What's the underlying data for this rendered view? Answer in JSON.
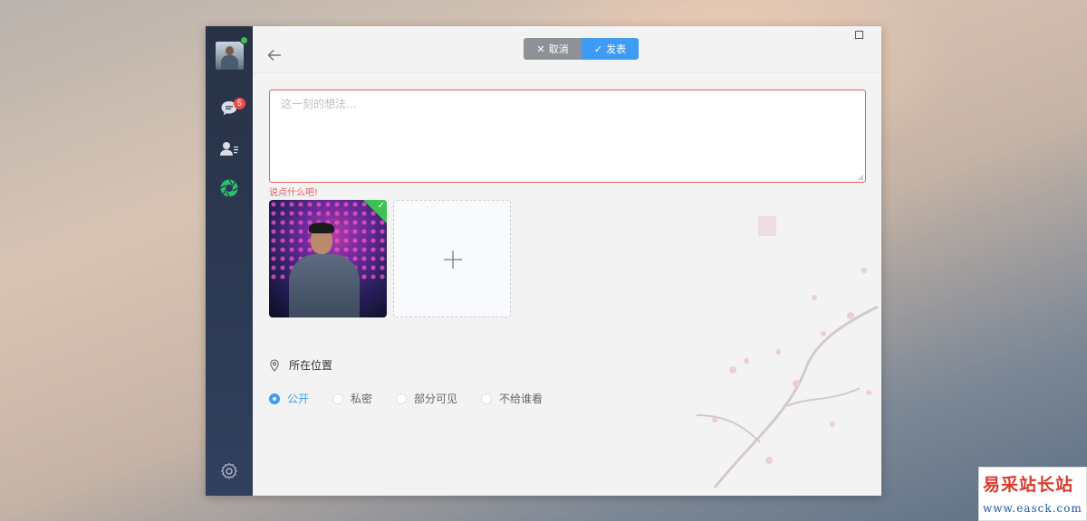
{
  "sidebar": {
    "chat_badge": "5"
  },
  "toolbar": {
    "cancel_label": "取消",
    "publish_label": "发表"
  },
  "editor": {
    "placeholder": "这一刻的想法...",
    "validation_message": "说点什么吧!"
  },
  "location": {
    "label": "所在位置"
  },
  "privacy": {
    "options": [
      {
        "label": "公开",
        "selected": true
      },
      {
        "label": "私密",
        "selected": false
      },
      {
        "label": "部分可见",
        "selected": false
      },
      {
        "label": "不给谁看",
        "selected": false
      }
    ]
  },
  "watermark": {
    "title": "易采站长站",
    "url": "www.easck.com"
  },
  "colors": {
    "accent": "#3f9cf4",
    "error": "#e35d5d",
    "online": "#3cc251",
    "sidebar": "#2d3a55"
  },
  "icons": [
    "chat-icon",
    "contacts-icon",
    "moments-icon",
    "settings-icon",
    "back-arrow-icon",
    "maximize-icon",
    "location-pin-icon",
    "plus-icon",
    "check-icon"
  ]
}
